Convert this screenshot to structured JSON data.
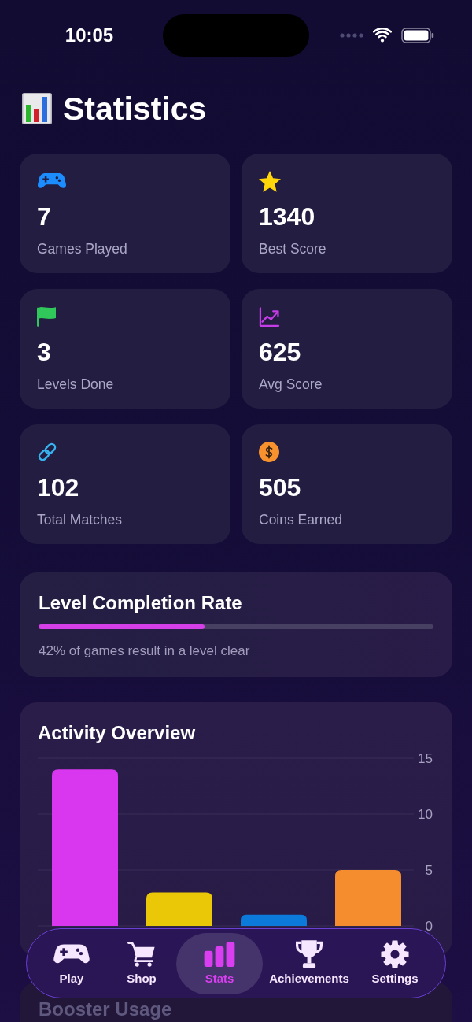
{
  "status_bar": {
    "time": "10:05"
  },
  "header": {
    "title": "Statistics"
  },
  "stat_cards": [
    {
      "kind": "gamepad",
      "value": "7",
      "label": "Games Played"
    },
    {
      "kind": "star",
      "value": "1340",
      "label": "Best Score"
    },
    {
      "kind": "flag",
      "value": "3",
      "label": "Levels Done"
    },
    {
      "kind": "trend",
      "value": "625",
      "label": "Avg Score"
    },
    {
      "kind": "link",
      "value": "102",
      "label": "Total Matches"
    },
    {
      "kind": "coin",
      "value": "505",
      "label": "Coins Earned"
    }
  ],
  "completion": {
    "title": "Level Completion Rate",
    "level": 0.42,
    "caption": "42% of games result in a level clear"
  },
  "activity": {
    "title": "Activity Overview",
    "chart_data": {
      "type": "bar",
      "values": [
        14,
        3,
        1,
        5
      ],
      "colors": [
        "#d936f0",
        "#ebc807",
        "#0b7ada",
        "#f58d2e"
      ],
      "ylim": [
        0,
        15
      ],
      "yticks": [
        0,
        5,
        10,
        15
      ]
    }
  },
  "next_section": {
    "title": "Booster Usage"
  },
  "tab_bar": {
    "items": [
      {
        "kind": "gamepad",
        "label": "Play",
        "selected": false
      },
      {
        "kind": "cart",
        "label": "Shop",
        "selected": false
      },
      {
        "kind": "bars",
        "label": "Stats",
        "selected": true
      },
      {
        "kind": "trophy",
        "label": "Achievements",
        "selected": false
      },
      {
        "kind": "gear",
        "label": "Settings",
        "selected": false
      }
    ]
  }
}
